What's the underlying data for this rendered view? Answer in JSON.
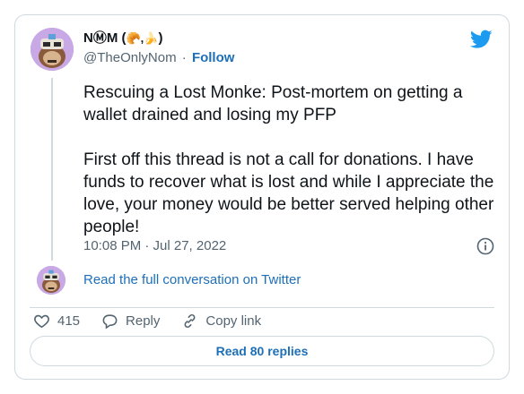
{
  "tweet": {
    "author_name": "NⓂM (",
    "author_emoji": "🥐,🍌",
    "author_name_end": ")",
    "handle": "@TheOnlyNom",
    "separator": "·",
    "follow_label": "Follow",
    "paragraphs": [
      "Rescuing a Lost Monke: Post-mortem on getting a wallet drained and losing my PFP",
      "First off this thread is not a call for donations. I have funds to recover what is lost and while I appreciate the love, your money would be better served helping other people!"
    ],
    "timestamp": "10:08 PM · Jul 27, 2022",
    "read_conversation": "Read the full conversation on Twitter",
    "like_count": "415",
    "reply_label": "Reply",
    "copy_link_label": "Copy link",
    "read_replies_label": "Read 80 replies"
  },
  "icons": {
    "logo": "twitter-bird-icon",
    "info": "info-icon",
    "like": "heart-icon",
    "reply": "reply-bubble-icon",
    "copy": "link-icon"
  },
  "colors": {
    "accent": "#1d9bf0",
    "link": "#1d6fb8",
    "muted": "#536471",
    "border": "#cfd9de",
    "text": "#0f1419"
  }
}
